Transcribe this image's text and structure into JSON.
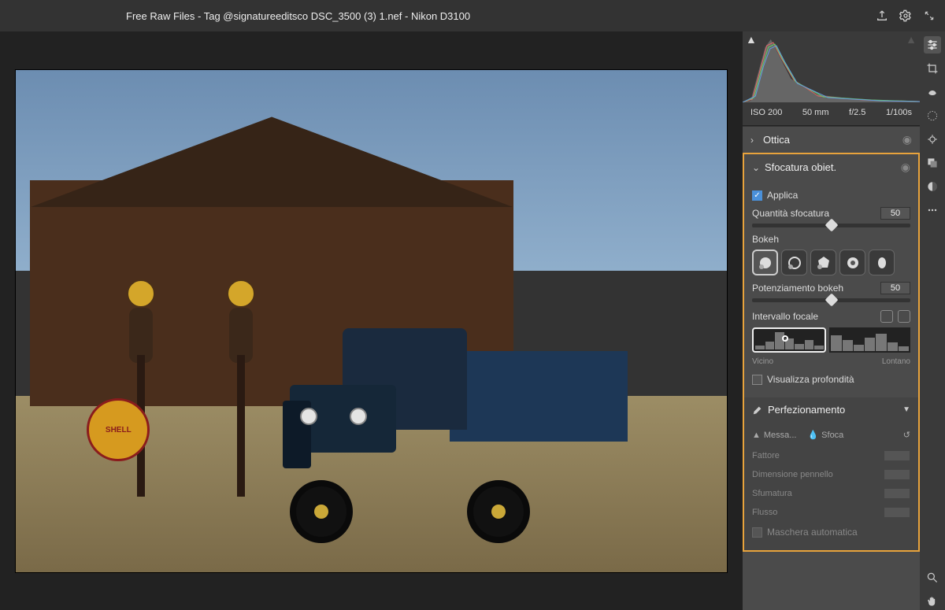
{
  "header": {
    "title": "Free Raw Files - Tag @signatureeditsco DSC_3500 (3) 1.nef  -  Nikon D3100"
  },
  "exif": {
    "iso": "ISO 200",
    "focal": "50 mm",
    "aperture": "f/2.5",
    "shutter": "1/100s"
  },
  "panels": {
    "ottica": {
      "title": "Ottica"
    },
    "blur": {
      "title": "Sfocatura obiet.",
      "apply": "Applica",
      "amount_label": "Quantità sfocatura",
      "amount_value": "50",
      "bokeh_label": "Bokeh",
      "boost_label": "Potenziamento bokeh",
      "boost_value": "50",
      "focal_label": "Intervallo focale",
      "near": "Vicino",
      "far": "Lontano",
      "depth": "Visualizza profondità"
    },
    "refine": {
      "title": "Perfezionamento",
      "focus": "Messa...",
      "blur": "Sfoca",
      "factor": "Fattore",
      "brush": "Dimensione pennello",
      "feather": "Sfumatura",
      "flow": "Flusso",
      "automask": "Maschera automatica"
    }
  },
  "sign": "SHELL"
}
